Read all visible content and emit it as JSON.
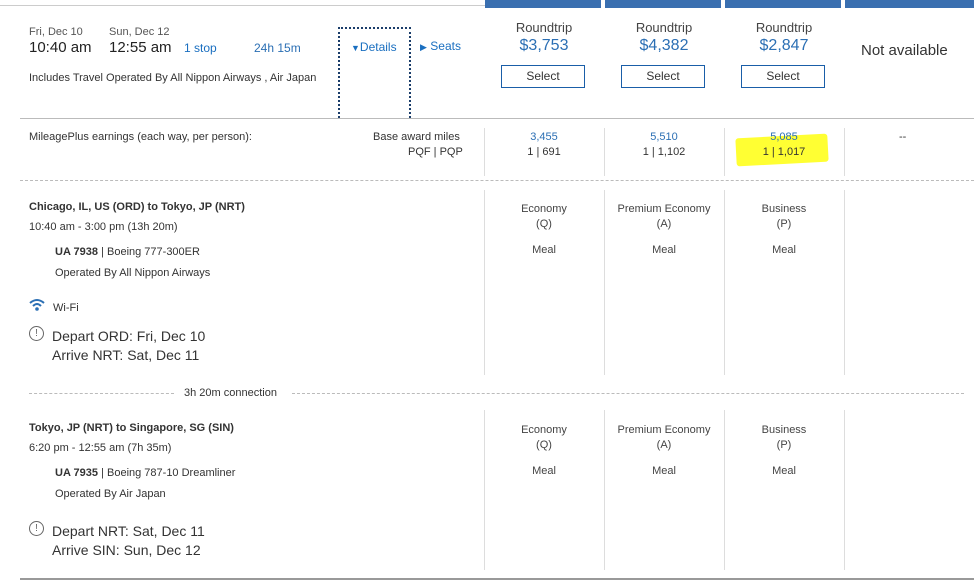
{
  "flight": {
    "depart_date": "Fri, Dec 10",
    "arrive_date": "Sun, Dec 12",
    "depart_time": "10:40 am",
    "arrive_time": "12:55 am",
    "stops": "1 stop",
    "duration": "24h 15m",
    "details_label": "Details",
    "seats_label": "Seats",
    "operated_note": "Includes Travel Operated By All Nippon Airways , Air Japan"
  },
  "fares": [
    {
      "type": "Roundtrip",
      "price": "$3,753",
      "select_label": "Select",
      "miles": "3,455",
      "pqf": "1 | 691",
      "cabin": "Economy",
      "code": "(Q)",
      "meal": "Meal"
    },
    {
      "type": "Roundtrip",
      "price": "$4,382",
      "select_label": "Select",
      "miles": "5,510",
      "pqf": "1 | 1,102",
      "cabin": "Premium Economy",
      "code": "(A)",
      "meal": "Meal"
    },
    {
      "type": "Roundtrip",
      "price": "$2,847",
      "select_label": "Select",
      "miles": "5,085",
      "pqf": "1 | 1,017",
      "cabin": "Business",
      "code": "(P)",
      "meal": "Meal"
    }
  ],
  "not_available": "Not available",
  "not_available_dash": "--",
  "earnings": {
    "label": "MileagePlus earnings (each way, per person):",
    "base_label": "Base award miles",
    "pqf_label": "PQF | PQP"
  },
  "segments": [
    {
      "route": "Chicago, IL, US (ORD) to Tokyo, JP (NRT)",
      "times": "10:40 am - 3:00 pm (13h 20m)",
      "flight_no": "UA 7938",
      "aircraft": "| Boeing 777-300ER",
      "operated_by": "Operated By All Nippon Airways",
      "wifi": "Wi-Fi",
      "depart_note": "Depart ORD: Fri, Dec 10",
      "arrive_note": "Arrive NRT: Sat, Dec 11"
    },
    {
      "route": "Tokyo, JP (NRT) to Singapore, SG (SIN)",
      "times": "6:20 pm - 12:55 am (7h 35m)",
      "flight_no": "UA 7935",
      "aircraft": "| Boeing 787-10 Dreamliner",
      "operated_by": "Operated By Air Japan",
      "depart_note": "Depart NRT: Sat, Dec 11",
      "arrive_note": "Arrive SIN: Sun, Dec 12"
    }
  ],
  "connection": "3h 20m connection",
  "colors": {
    "accent": "#2b6fb4",
    "highlight": "#ffff33",
    "topbar": "#3a6fb0"
  }
}
